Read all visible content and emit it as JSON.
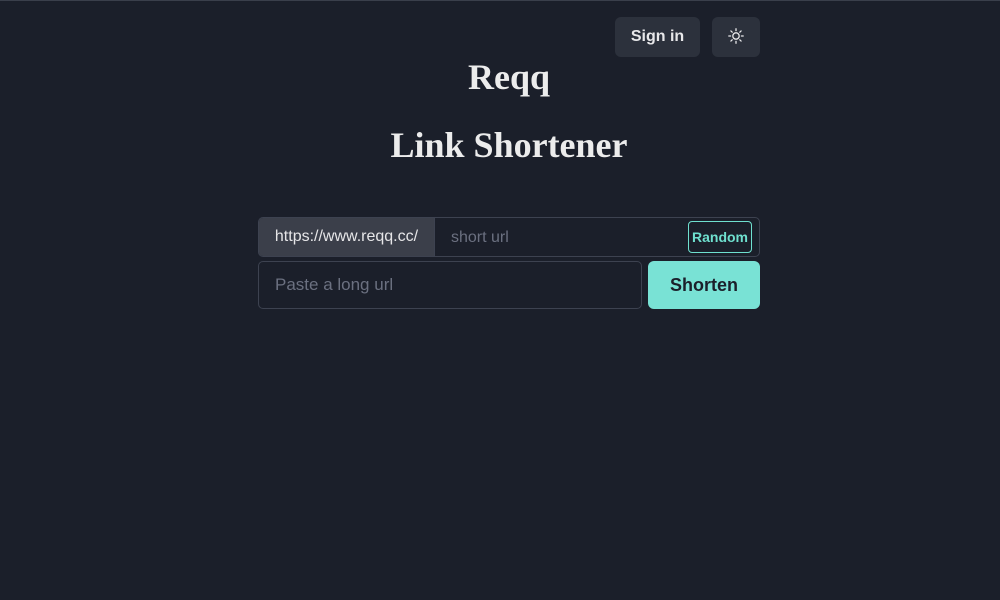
{
  "header": {
    "signin_label": "Sign in",
    "theme_icon": "sun-icon"
  },
  "main": {
    "title": "Reqq",
    "subtitle": "Link Shortener"
  },
  "shortener": {
    "prefix": "https://www.reqq.cc/",
    "short_placeholder": "short url",
    "short_value": "",
    "random_label": "Random",
    "long_placeholder": "Paste a long url",
    "long_value": "",
    "shorten_label": "Shorten"
  },
  "colors": {
    "background": "#1b1f2a",
    "accent": "#79e2d5",
    "button_bg": "#2c313c"
  }
}
